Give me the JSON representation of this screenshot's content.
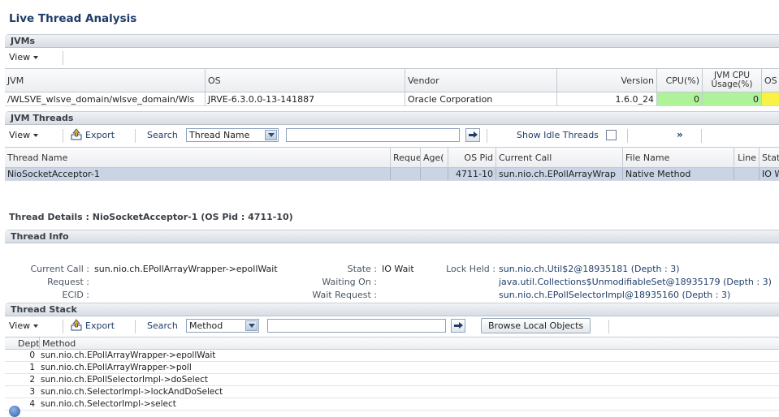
{
  "page": {
    "title": "Live Thread Analysis"
  },
  "jvms": {
    "header": "JVMs",
    "view_label": "View",
    "columns": [
      "JVM",
      "OS",
      "Vendor",
      "Version",
      "CPU(%)",
      "JVM CPU Usage(%)",
      "OS"
    ],
    "rows": [
      {
        "jvm": "/WLSVE_wlsve_domain/wlsve_domain/Wls",
        "os": "JRVE-6.3.0.0-13-141887",
        "vendor": "Oracle Corporation",
        "version": "1.6.0_24",
        "cpu": "0",
        "jvm_cpu": "0",
        "os_more": ""
      }
    ],
    "colors": {
      "cpu_cell": "#aef29a",
      "os_cell": "#f7f244"
    }
  },
  "jvm_threads": {
    "header": "JVM Threads",
    "view_label": "View",
    "export_label": "Export",
    "search_label": "Search",
    "search_select": "Thread Name",
    "search_value": "",
    "show_idle_label": "Show Idle Threads",
    "show_idle_checked": false,
    "more_label": "»",
    "columns": [
      "Thread Name",
      "Reques",
      "Age(",
      "OS Pid",
      "Current Call",
      "File Name",
      "Line",
      "Stat"
    ],
    "rows": [
      {
        "thread_name": "NioSocketAcceptor-1",
        "request": "",
        "age": "",
        "os_pid": "4711-10",
        "current_call": "sun.nio.ch.EPollArrayWrap",
        "file_name": "Native Method",
        "line": "",
        "state": "IO W"
      }
    ]
  },
  "thread_details": {
    "title": "Thread Details : NioSocketAcceptor-1 (OS Pid : 4711-10)"
  },
  "thread_info": {
    "header": "Thread Info",
    "current_call_label": "Current Call :",
    "current_call": "sun.nio.ch.EPollArrayWrapper->epollWait",
    "request_label": "Request :",
    "request": "",
    "ecid_label": "ECID :",
    "ecid": "",
    "state_label": "State :",
    "state": "IO Wait",
    "waiting_on_label": "Waiting On :",
    "waiting_on": "",
    "wait_request_label": "Wait Request :",
    "wait_request": "",
    "lock_held_label": "Lock Held :",
    "locks": [
      "sun.nio.ch.Util$2@18935181 (Depth : 3)",
      "java.util.Collections$UnmodifiableSet@18935179 (Depth : 3)",
      "sun.nio.ch.EPollSelectorImpl@18935160 (Depth : 3)"
    ]
  },
  "thread_stack": {
    "header": "Thread Stack",
    "view_label": "View",
    "export_label": "Export",
    "search_label": "Search",
    "search_select": "Method",
    "search_value": "",
    "browse_label": "Browse Local Objects",
    "columns": [
      "Depth",
      "Method"
    ],
    "rows": [
      {
        "depth": "0",
        "method": "sun.nio.ch.EPollArrayWrapper->epollWait"
      },
      {
        "depth": "1",
        "method": "sun.nio.ch.EPollArrayWrapper->poll"
      },
      {
        "depth": "2",
        "method": "sun.nio.ch.EPollSelectorImpl->doSelect"
      },
      {
        "depth": "3",
        "method": "sun.nio.ch.SelectorImpl->lockAndDoSelect"
      },
      {
        "depth": "4",
        "method": "sun.nio.ch.SelectorImpl->select"
      }
    ]
  }
}
